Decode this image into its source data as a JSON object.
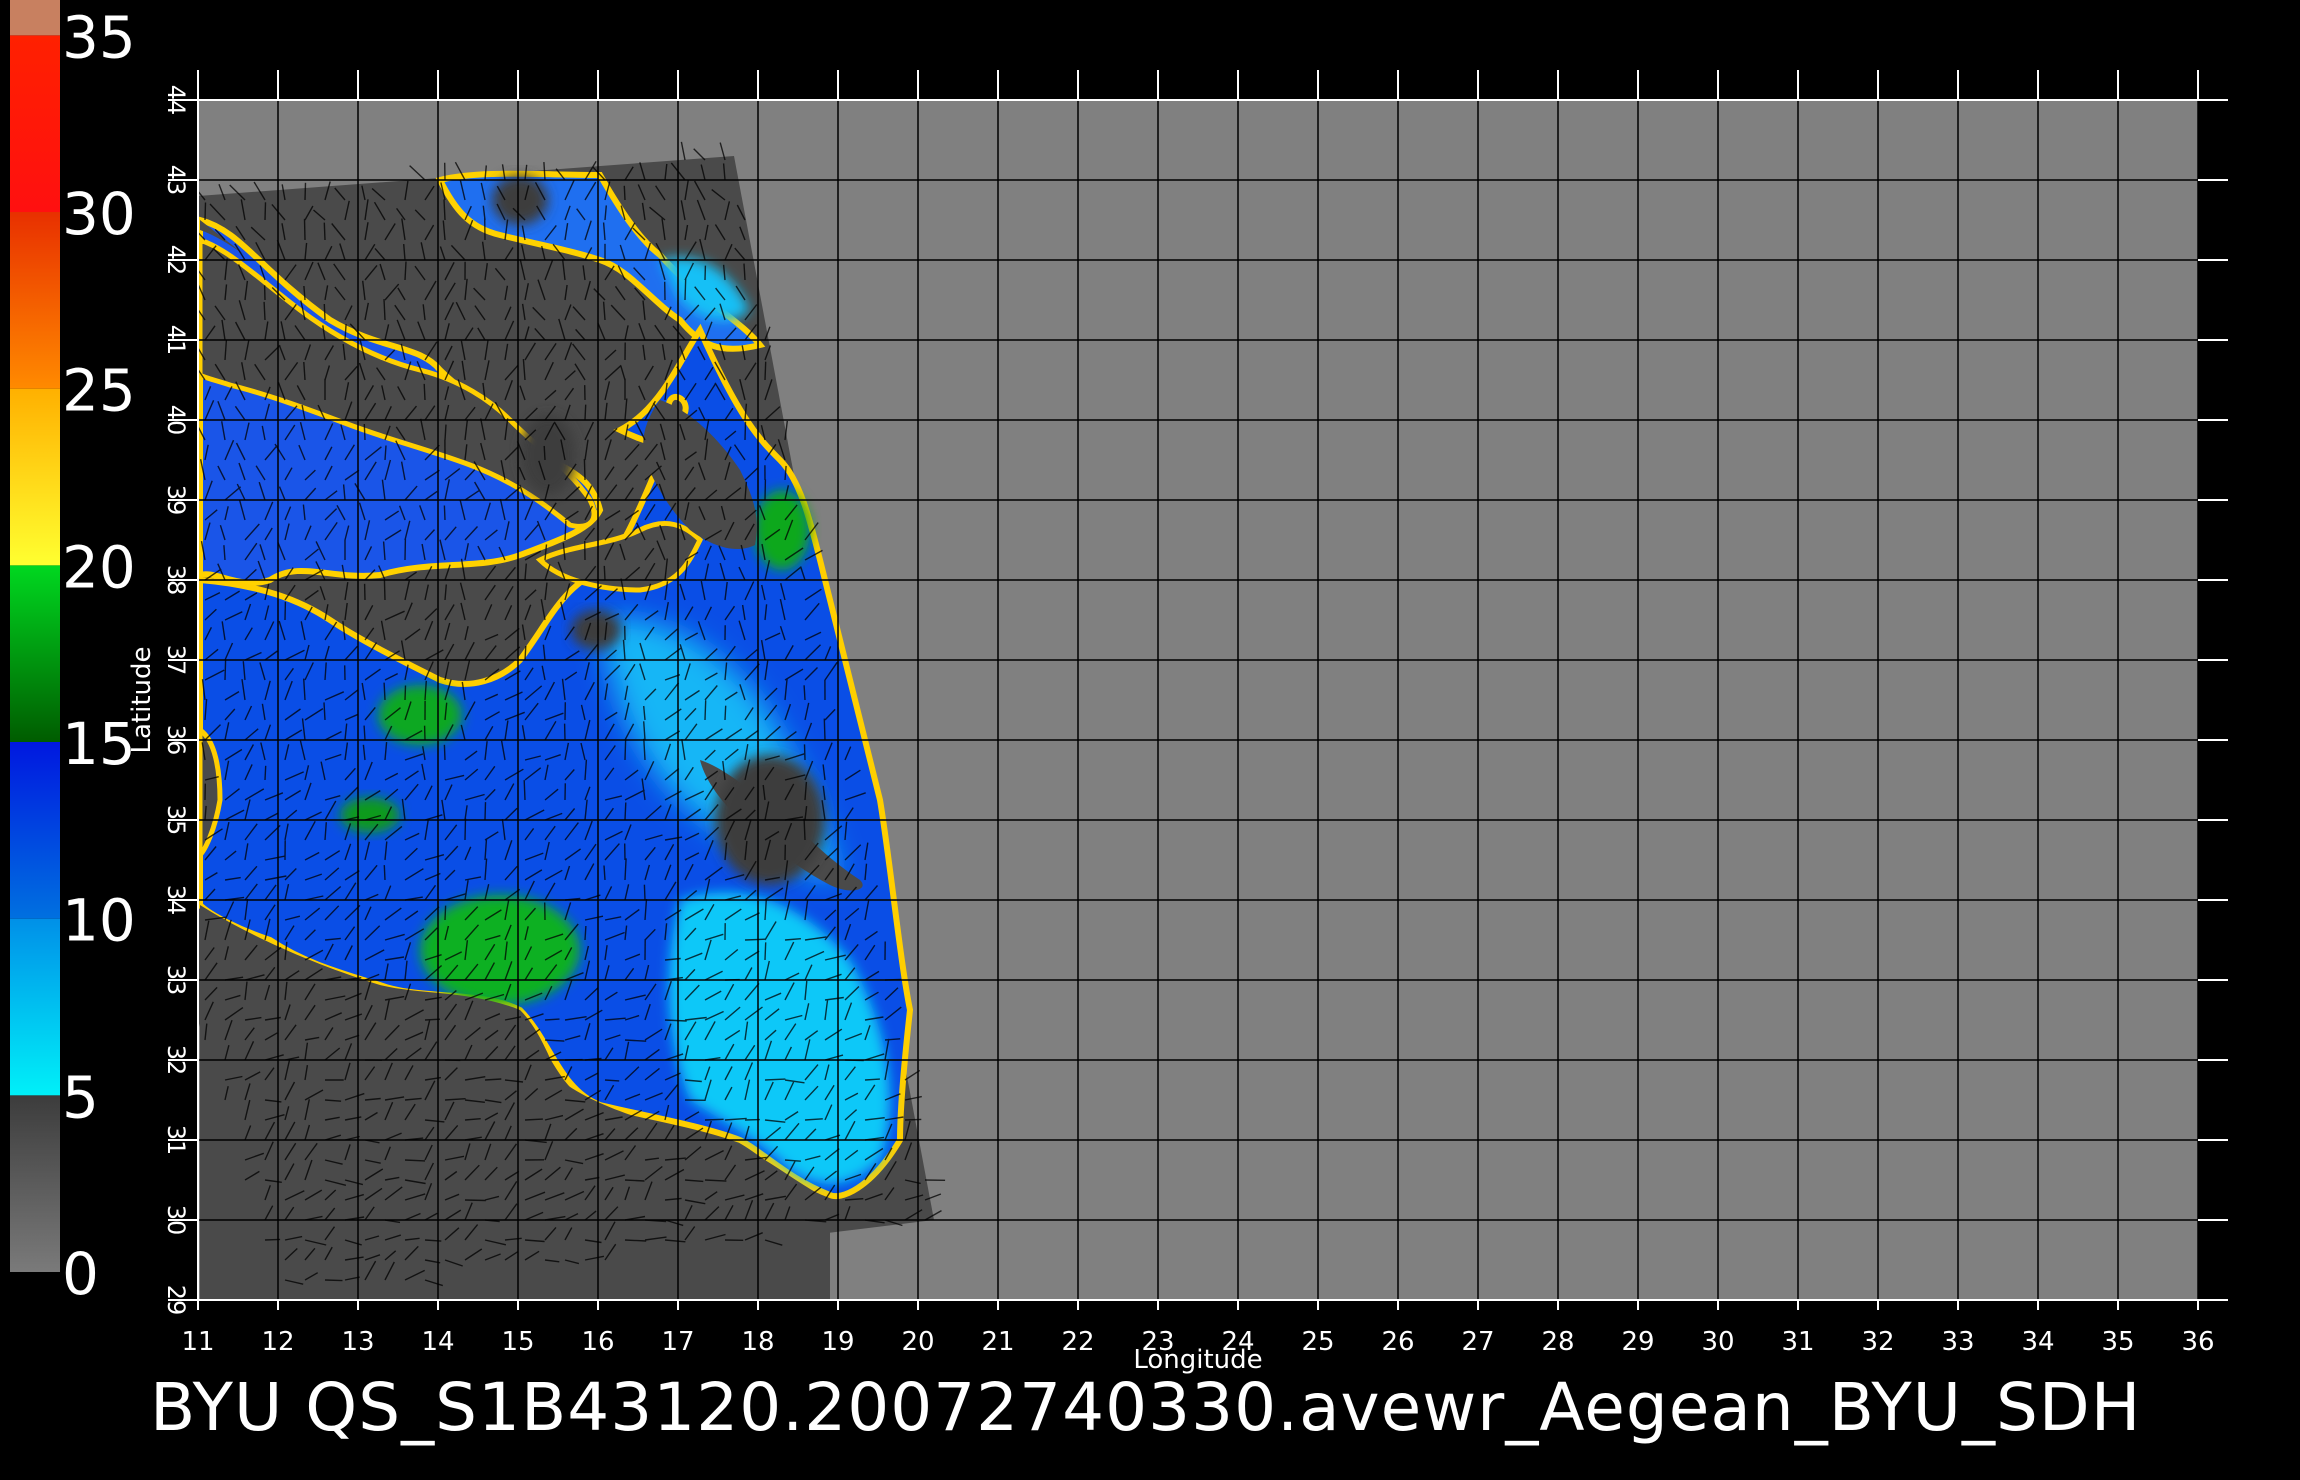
{
  "colorbar": {
    "labels": [
      "35",
      "30",
      "25",
      "20",
      "15",
      "10",
      "5",
      "0"
    ],
    "bands": [
      {
        "from": 0,
        "to": 5,
        "colors": [
          "#7a7a7a",
          "#3c3c3c"
        ]
      },
      {
        "from": 5,
        "to": 10,
        "colors": [
          "#00f0f8",
          "#0090e8"
        ]
      },
      {
        "from": 10,
        "to": 15,
        "colors": [
          "#0070e0",
          "#0018e0"
        ]
      },
      {
        "from": 15,
        "to": 20,
        "colors": [
          "#005c00",
          "#00d820"
        ]
      },
      {
        "from": 20,
        "to": 25,
        "colors": [
          "#ffff30",
          "#ffb000"
        ]
      },
      {
        "from": 25,
        "to": 30,
        "colors": [
          "#ff8a00",
          "#e83000"
        ]
      },
      {
        "from": 30,
        "to": 35,
        "colors": [
          "#ff1010",
          "#ff2000"
        ]
      },
      {
        "from": 35,
        "to": 36,
        "colors": [
          "#c88060",
          "#c88060"
        ]
      }
    ]
  },
  "map": {
    "lon_range": [
      11,
      36
    ],
    "lat_range": [
      29,
      44
    ],
    "lon_ticks": [
      "11",
      "12",
      "13",
      "14",
      "15",
      "16",
      "17",
      "18",
      "19",
      "20",
      "21",
      "22",
      "23",
      "24",
      "25",
      "26",
      "27",
      "28",
      "29",
      "30",
      "31",
      "32",
      "33",
      "34",
      "35",
      "36"
    ],
    "lat_ticks": [
      "29",
      "30",
      "31",
      "32",
      "33",
      "34",
      "35",
      "36",
      "37",
      "38",
      "39",
      "40",
      "41",
      "42",
      "43",
      "44"
    ],
    "xlabel": "Longitude",
    "ylabel": "Latitude",
    "background_color": "#808080",
    "swath_color": "#4a4a4a",
    "grid": true,
    "swath_corners": [
      [
        11.0,
        42.8
      ],
      [
        17.7,
        43.3
      ],
      [
        20.2,
        30.0
      ],
      [
        12.0,
        29.0
      ],
      [
        11.0,
        32.5
      ]
    ]
  },
  "footer": {
    "title": "BYU  QS_S1B43120.20072740330.avewr_Aegean_BYU_SDH"
  }
}
